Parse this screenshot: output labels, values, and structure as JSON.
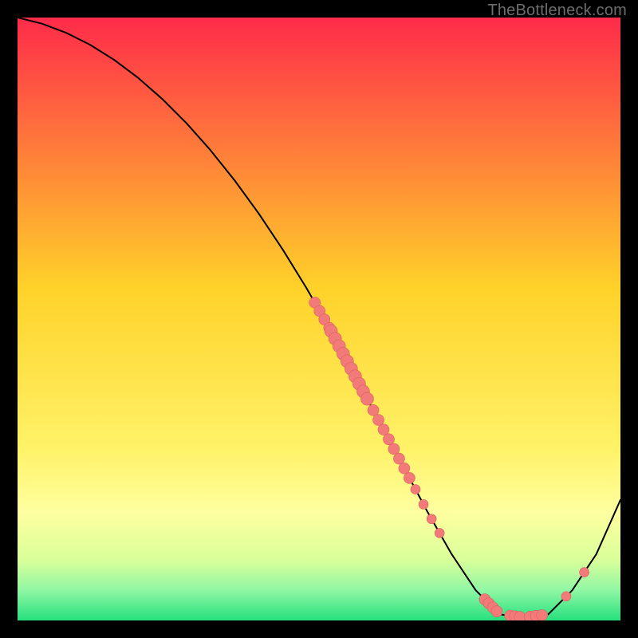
{
  "watermark": "TheBottleneck.com",
  "chart_data": {
    "type": "line",
    "title": "",
    "xlabel": "",
    "ylabel": "",
    "xlim": [
      0,
      100
    ],
    "ylim": [
      0,
      100
    ],
    "background": {
      "type": "vertical-gradient",
      "stops": [
        {
          "offset": 0.0,
          "color": "#ff2b4a"
        },
        {
          "offset": 0.45,
          "color": "#ffd229"
        },
        {
          "offset": 0.72,
          "color": "#fff36a"
        },
        {
          "offset": 0.82,
          "color": "#ffffa0"
        },
        {
          "offset": 0.9,
          "color": "#d9ff9a"
        },
        {
          "offset": 0.95,
          "color": "#90f7a4"
        },
        {
          "offset": 1.0,
          "color": "#25e07e"
        }
      ]
    },
    "curve": {
      "x": [
        0,
        4,
        8,
        12,
        16,
        20,
        24,
        28,
        32,
        36,
        40,
        44,
        48,
        52,
        56,
        60,
        64,
        68,
        72,
        76,
        80,
        84,
        88,
        92,
        96,
        100
      ],
      "y": [
        100,
        99,
        97.5,
        95.5,
        93,
        90,
        86.5,
        82.5,
        78,
        73,
        67.5,
        61.5,
        55,
        48,
        40.5,
        33,
        25.5,
        18,
        11,
        5,
        1,
        0.5,
        1,
        5,
        11,
        20
      ],
      "stroke": "#000000",
      "width": 2
    },
    "clusters_on_curve": [
      {
        "x_center": 50.5,
        "spread": 1.2,
        "count": 4,
        "size": 7
      },
      {
        "x_center": 55.0,
        "spread": 3.0,
        "count": 10,
        "size": 8
      },
      {
        "x_center": 62.0,
        "spread": 3.0,
        "count": 8,
        "size": 7
      },
      {
        "x_center": 68.0,
        "spread": 2.0,
        "count": 4,
        "size": 6
      },
      {
        "x_center": 78.5,
        "spread": 1.0,
        "count": 4,
        "size": 7
      },
      {
        "x_center": 82.5,
        "spread": 0.8,
        "count": 3,
        "size": 7
      },
      {
        "x_center": 86.0,
        "spread": 1.0,
        "count": 3,
        "size": 7
      },
      {
        "x_center": 91.0,
        "spread": 0.3,
        "count": 1,
        "size": 6
      },
      {
        "x_center": 94.0,
        "spread": 0.3,
        "count": 1,
        "size": 6
      }
    ],
    "marker_color": "#f27b79",
    "marker_stroke": "#d8605e"
  }
}
